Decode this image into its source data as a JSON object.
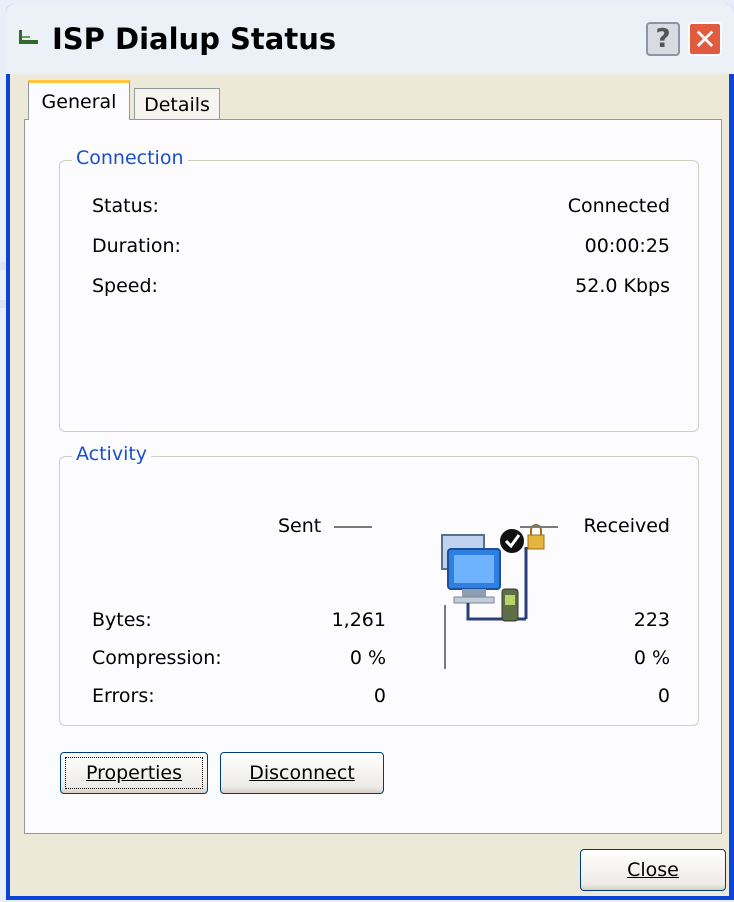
{
  "window": {
    "title": "ISP Dialup Status",
    "help_label": "?",
    "close_label": "✕"
  },
  "tabs": [
    {
      "label": "General",
      "selected": true
    },
    {
      "label": "Details",
      "selected": false
    }
  ],
  "connection": {
    "group_label": "Connection",
    "rows": [
      {
        "label": "Status:",
        "value": "Connected"
      },
      {
        "label": "Duration:",
        "value": "00:00:25"
      },
      {
        "label": "Speed:",
        "value": "52.0 Kbps"
      }
    ]
  },
  "activity": {
    "group_label": "Activity",
    "sent_label": "Sent",
    "received_label": "Received",
    "icon": "network-connection-secured-icon",
    "rows": [
      {
        "label": "Bytes:",
        "sent": "1,261",
        "received": "223"
      },
      {
        "label": "Compression:",
        "sent": "0 %",
        "received": "0 %"
      },
      {
        "label": "Errors:",
        "sent": "0",
        "received": "0"
      }
    ]
  },
  "buttons": {
    "properties": "Properties",
    "disconnect": "Disconnect",
    "close": "Close"
  },
  "colors": {
    "titlebar_frame": "#0b45d7",
    "group_label": "#1a4fc6",
    "close_button": "#e35b3f",
    "active_tab_accent": "#ffc83c"
  }
}
